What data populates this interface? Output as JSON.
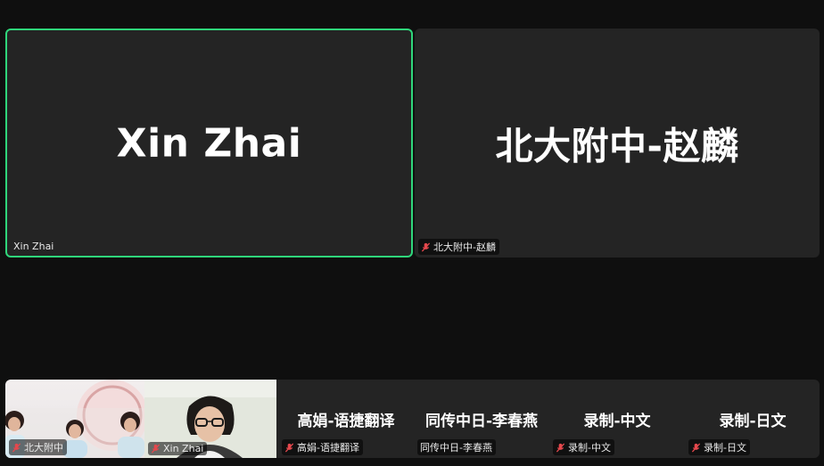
{
  "participants": {
    "main_left": {
      "display_name": "Xin Zhai",
      "tag": "Xin Zhai"
    },
    "main_right": {
      "display_name": "北大附中-赵麟",
      "tag": "北大附中-赵麟"
    },
    "video1": {
      "tag": "北大附中"
    },
    "video2": {
      "tag": "Xin Zhai"
    },
    "mini1": {
      "display_name": "高娟-语捷翻译",
      "tag": "高娟-语捷翻译"
    },
    "mini2": {
      "display_name": "同传中日-李春燕",
      "tag": "同传中日-李春燕"
    },
    "mini3": {
      "display_name": "录制-中文",
      "tag": "录制-中文"
    },
    "mini4": {
      "display_name": "录制-日文",
      "tag": "录制-日文"
    }
  },
  "colors": {
    "active_speaker_border": "#2fd67b",
    "muted_icon": "#e5484d",
    "tile_background": "#242424",
    "page_background": "#0f0f0f"
  },
  "icons": {
    "muted": "mic-off-icon"
  }
}
